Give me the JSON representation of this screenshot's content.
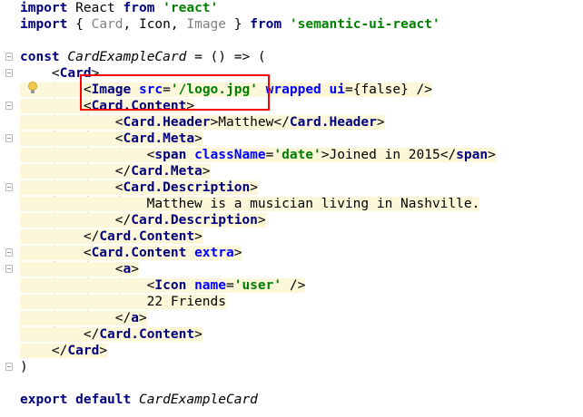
{
  "lines": [
    {
      "segments": [
        {
          "t": "import",
          "c": "kw"
        },
        {
          "t": " React ",
          "c": ""
        },
        {
          "t": "from",
          "c": "kw"
        },
        {
          "t": " ",
          "c": ""
        },
        {
          "t": "'react'",
          "c": "str"
        }
      ]
    },
    {
      "segments": [
        {
          "t": "import",
          "c": "kw"
        },
        {
          "t": " { ",
          "c": ""
        },
        {
          "t": "Card",
          "c": "imp"
        },
        {
          "t": ", Icon, ",
          "c": ""
        },
        {
          "t": "Image",
          "c": "imp"
        },
        {
          "t": " } ",
          "c": ""
        },
        {
          "t": "from",
          "c": "kw"
        },
        {
          "t": " ",
          "c": ""
        },
        {
          "t": "'semantic-ui-react'",
          "c": "str"
        }
      ]
    },
    {
      "segments": []
    },
    {
      "segments": [
        {
          "t": "const",
          "c": "kw"
        },
        {
          "t": " ",
          "c": ""
        },
        {
          "t": "CardExampleCard",
          "c": "ital"
        },
        {
          "t": " = () => (",
          "c": ""
        }
      ]
    },
    {
      "segments": [
        {
          "t": "    <",
          "c": ""
        },
        {
          "t": "Card",
          "c": "tag"
        },
        {
          "t": ">",
          "c": ""
        }
      ]
    },
    {
      "segments": [
        {
          "t": "        <",
          "c": ""
        },
        {
          "t": "Image",
          "c": "tag"
        },
        {
          "t": " ",
          "c": ""
        },
        {
          "t": "src",
          "c": "attr"
        },
        {
          "t": "=",
          "c": ""
        },
        {
          "t": "'/logo.jpg'",
          "c": "str"
        },
        {
          "t": " ",
          "c": ""
        },
        {
          "t": "wrapped",
          "c": "attr"
        },
        {
          "t": " ",
          "c": ""
        },
        {
          "t": "ui",
          "c": "attr"
        },
        {
          "t": "={false} />",
          "c": ""
        }
      ]
    },
    {
      "segments": [
        {
          "t": "        <",
          "c": ""
        },
        {
          "t": "Card.Content",
          "c": "tag"
        },
        {
          "t": ">",
          "c": ""
        }
      ]
    },
    {
      "segments": [
        {
          "t": "            <",
          "c": ""
        },
        {
          "t": "Card.Header",
          "c": "tag"
        },
        {
          "t": ">Matthew</",
          "c": ""
        },
        {
          "t": "Card.Header",
          "c": "tag"
        },
        {
          "t": ">",
          "c": ""
        }
      ]
    },
    {
      "segments": [
        {
          "t": "            <",
          "c": ""
        },
        {
          "t": "Card.Meta",
          "c": "tag"
        },
        {
          "t": ">",
          "c": ""
        }
      ]
    },
    {
      "segments": [
        {
          "t": "                <",
          "c": ""
        },
        {
          "t": "span",
          "c": "tag"
        },
        {
          "t": " ",
          "c": ""
        },
        {
          "t": "className",
          "c": "attr"
        },
        {
          "t": "=",
          "c": ""
        },
        {
          "t": "'date'",
          "c": "str"
        },
        {
          "t": ">Joined in 2015</",
          "c": ""
        },
        {
          "t": "span",
          "c": "tag"
        },
        {
          "t": ">",
          "c": ""
        }
      ]
    },
    {
      "segments": [
        {
          "t": "            </",
          "c": ""
        },
        {
          "t": "Card.Meta",
          "c": "tag"
        },
        {
          "t": ">",
          "c": ""
        }
      ]
    },
    {
      "segments": [
        {
          "t": "            <",
          "c": ""
        },
        {
          "t": "Card.Description",
          "c": "tag"
        },
        {
          "t": ">",
          "c": ""
        }
      ]
    },
    {
      "segments": [
        {
          "t": "                Matthew is a musician living in Nashville.",
          "c": ""
        }
      ]
    },
    {
      "segments": [
        {
          "t": "            </",
          "c": ""
        },
        {
          "t": "Card.Description",
          "c": "tag"
        },
        {
          "t": ">",
          "c": ""
        }
      ]
    },
    {
      "segments": [
        {
          "t": "        </",
          "c": ""
        },
        {
          "t": "Card.Content",
          "c": "tag"
        },
        {
          "t": ">",
          "c": ""
        }
      ]
    },
    {
      "segments": [
        {
          "t": "        <",
          "c": ""
        },
        {
          "t": "Card.Content",
          "c": "tag"
        },
        {
          "t": " ",
          "c": ""
        },
        {
          "t": "extra",
          "c": "attr"
        },
        {
          "t": ">",
          "c": ""
        }
      ]
    },
    {
      "segments": [
        {
          "t": "            <",
          "c": ""
        },
        {
          "t": "a",
          "c": "tag"
        },
        {
          "t": ">",
          "c": ""
        }
      ]
    },
    {
      "segments": [
        {
          "t": "                <",
          "c": ""
        },
        {
          "t": "Icon",
          "c": "tag"
        },
        {
          "t": " ",
          "c": ""
        },
        {
          "t": "name",
          "c": "attr"
        },
        {
          "t": "=",
          "c": ""
        },
        {
          "t": "'user'",
          "c": "str"
        },
        {
          "t": " />",
          "c": ""
        }
      ]
    },
    {
      "segments": [
        {
          "t": "                22 Friends",
          "c": ""
        }
      ]
    },
    {
      "segments": [
        {
          "t": "            </",
          "c": ""
        },
        {
          "t": "a",
          "c": "tag"
        },
        {
          "t": ">",
          "c": ""
        }
      ]
    },
    {
      "segments": [
        {
          "t": "        </",
          "c": ""
        },
        {
          "t": "Card.Content",
          "c": "tag"
        },
        {
          "t": ">",
          "c": ""
        }
      ]
    },
    {
      "segments": [
        {
          "t": "    </",
          "c": ""
        },
        {
          "t": "Card",
          "c": "tag"
        },
        {
          "t": ">",
          "c": ""
        }
      ]
    },
    {
      "segments": [
        {
          "t": ")",
          "c": ""
        }
      ]
    },
    {
      "segments": []
    },
    {
      "segments": [
        {
          "t": "export",
          "c": "kw"
        },
        {
          "t": " ",
          "c": ""
        },
        {
          "t": "default",
          "c": "kw"
        },
        {
          "t": " ",
          "c": ""
        },
        {
          "t": "CardExampleCard",
          "c": "ital"
        }
      ]
    }
  ]
}
